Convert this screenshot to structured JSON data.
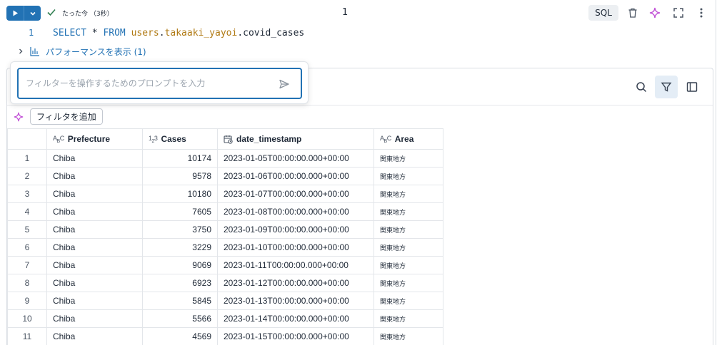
{
  "toolbar": {
    "run_icon": "play-icon",
    "status_text": "たった今 （3秒）",
    "cell_number": "1",
    "language_badge": "SQL"
  },
  "editor": {
    "line_number": "1",
    "keyword_select": "SELECT",
    "star": "*",
    "keyword_from": "FROM",
    "table_path": "users.takaaki_yayoi.covid_cases",
    "schema": "users",
    "catalog": "takaaki_yayoi",
    "table": "covid_cases"
  },
  "performance": {
    "label": "パフォーマンスを表示 (1)"
  },
  "filter_prompt": {
    "placeholder": "フィルターを操作するためのプロンプトを入力"
  },
  "filter_bar": {
    "add_filter_label": "フィルタを追加"
  },
  "table": {
    "columns": [
      {
        "name": "Prefecture",
        "type_icon": "string-type-icon"
      },
      {
        "name": "Cases",
        "type_icon": "integer-type-icon"
      },
      {
        "name": "date_timestamp",
        "type_icon": "timestamp-type-icon"
      },
      {
        "name": "Area",
        "type_icon": "string-type-icon"
      }
    ],
    "rows": [
      {
        "n": "1",
        "prefecture": "Chiba",
        "cases": "10174",
        "date": "2023-01-05T00:00:00.000+00:00",
        "area": "関東地方"
      },
      {
        "n": "2",
        "prefecture": "Chiba",
        "cases": "9578",
        "date": "2023-01-06T00:00:00.000+00:00",
        "area": "関東地方"
      },
      {
        "n": "3",
        "prefecture": "Chiba",
        "cases": "10180",
        "date": "2023-01-07T00:00:00.000+00:00",
        "area": "関東地方"
      },
      {
        "n": "4",
        "prefecture": "Chiba",
        "cases": "7605",
        "date": "2023-01-08T00:00:00.000+00:00",
        "area": "関東地方"
      },
      {
        "n": "5",
        "prefecture": "Chiba",
        "cases": "3750",
        "date": "2023-01-09T00:00:00.000+00:00",
        "area": "関東地方"
      },
      {
        "n": "6",
        "prefecture": "Chiba",
        "cases": "3229",
        "date": "2023-01-10T00:00:00.000+00:00",
        "area": "関東地方"
      },
      {
        "n": "7",
        "prefecture": "Chiba",
        "cases": "9069",
        "date": "2023-01-11T00:00:00.000+00:00",
        "area": "関東地方"
      },
      {
        "n": "8",
        "prefecture": "Chiba",
        "cases": "6923",
        "date": "2023-01-12T00:00:00.000+00:00",
        "area": "関東地方"
      },
      {
        "n": "9",
        "prefecture": "Chiba",
        "cases": "5845",
        "date": "2023-01-13T00:00:00.000+00:00",
        "area": "関東地方"
      },
      {
        "n": "10",
        "prefecture": "Chiba",
        "cases": "5566",
        "date": "2023-01-14T00:00:00.000+00:00",
        "area": "関東地方"
      },
      {
        "n": "11",
        "prefecture": "Chiba",
        "cases": "4569",
        "date": "2023-01-15T00:00:00.000+00:00",
        "area": "関東地方"
      }
    ]
  },
  "colors": {
    "accent": "#2272b4",
    "keyword": "#2272b4",
    "table_identifier": "#b07a14",
    "ai_sparkle": "#c04fd6"
  }
}
